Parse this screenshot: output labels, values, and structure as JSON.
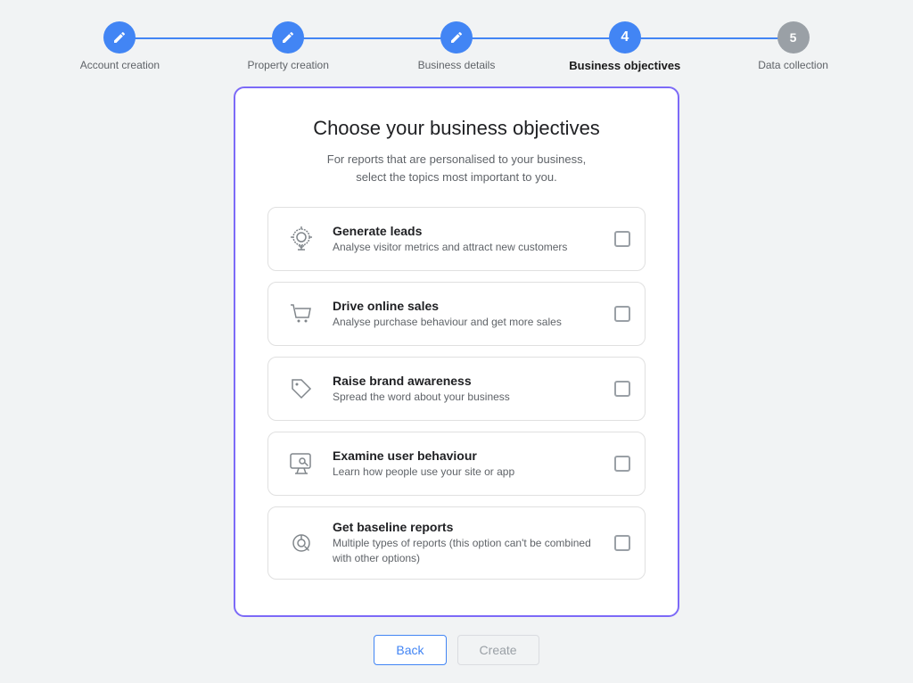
{
  "stepper": {
    "steps": [
      {
        "id": "account",
        "label": "Account creation",
        "state": "done",
        "number": "✎"
      },
      {
        "id": "property",
        "label": "Property creation",
        "state": "done",
        "number": "✎"
      },
      {
        "id": "business_details",
        "label": "Business details",
        "state": "done",
        "number": "✎"
      },
      {
        "id": "business_objectives",
        "label": "Business objectives",
        "state": "active",
        "number": "4"
      },
      {
        "id": "data_collection",
        "label": "Data collection",
        "state": "pending",
        "number": "5"
      }
    ]
  },
  "card": {
    "title": "Choose your business objectives",
    "subtitle": "For reports that are personalised to your business,\nselect the topics most important to you."
  },
  "objectives": [
    {
      "id": "generate_leads",
      "title": "Generate leads",
      "description": "Analyse visitor metrics and attract new customers",
      "icon": "target"
    },
    {
      "id": "drive_online_sales",
      "title": "Drive online sales",
      "description": "Analyse purchase behaviour and get more sales",
      "icon": "cart"
    },
    {
      "id": "raise_brand_awareness",
      "title": "Raise brand awareness",
      "description": "Spread the word about your business",
      "icon": "tag"
    },
    {
      "id": "examine_user_behaviour",
      "title": "Examine user behaviour",
      "description": "Learn how people use your site or app",
      "icon": "monitor"
    },
    {
      "id": "get_baseline_reports",
      "title": "Get baseline reports",
      "description": "Multiple types of reports (this option can't be combined with other options)",
      "icon": "report"
    }
  ],
  "buttons": {
    "back": "Back",
    "create": "Create"
  },
  "colors": {
    "primary": "#4285f4",
    "accent": "#7c6af7",
    "active_step": "#4285f4",
    "pending_step": "#9aa0a6"
  }
}
